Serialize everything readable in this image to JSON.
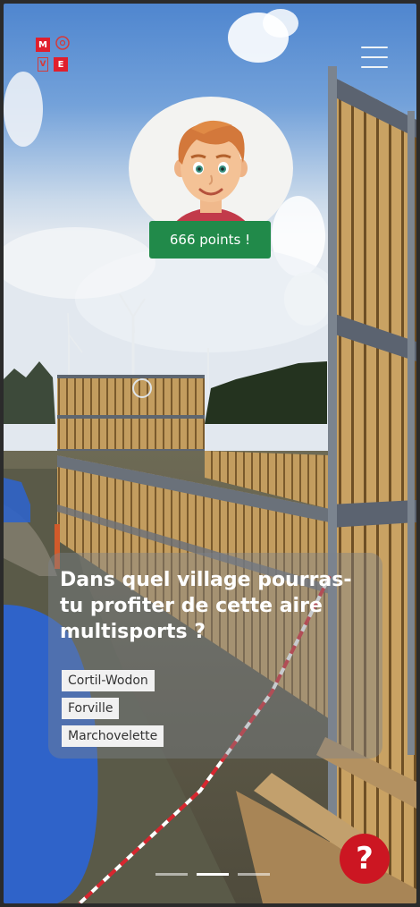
{
  "app": {
    "logo_letters": [
      "M",
      "V",
      "E"
    ],
    "brand_color": "#e01f2d"
  },
  "header": {
    "menu_icon": "hamburger-menu-icon"
  },
  "profile": {
    "avatar_icon": "boy-avatar-icon",
    "points_label": "666 points !",
    "badge_color": "#218a4a"
  },
  "quiz": {
    "question": "Dans quel village pourras-tu profiter de cette aire multisports ?",
    "answers": [
      "Cortil-Wodon",
      "Forville",
      "Marchovelette"
    ]
  },
  "pager": {
    "slides": 3,
    "active_index": 1
  },
  "help": {
    "label": "?",
    "icon": "question-mark-icon",
    "color": "#cc1622"
  }
}
